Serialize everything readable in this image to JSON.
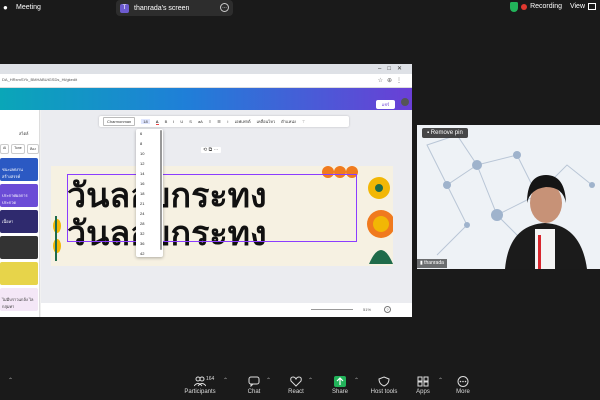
{
  "topbar": {
    "app_title": "Meeting",
    "screen_owner_initial": "T",
    "screen_label": "thanrada's screen",
    "recording_label": "Recording",
    "view_label": "View"
  },
  "browser": {
    "url": "DA_HRxmSYk_BMHABUtGSDs_Hl/gkedit"
  },
  "canva": {
    "share_button": "แชร์",
    "left_panel_title": "สไตล์",
    "chips": [
      "Al",
      "Tone",
      "ห้อง"
    ],
    "thumbs": [
      "ชนะเลศงานสร้างสรรค์",
      "ประกาศผลการประกวด",
      "เนื้อหา",
      "",
      "",
      "ไม่มีบราวแกล้ง ไลกลุ่มทา"
    ],
    "toolbar": {
      "font": "Charmonman",
      "size": "18",
      "effects": "เอฟเฟกต์",
      "animate": "เคลื่อนไหว",
      "position": "ตำแหน่ง"
    },
    "font_sizes": [
      "6",
      "8",
      "10",
      "12",
      "14",
      "16",
      "18",
      "21",
      "24",
      "28",
      "32",
      "36",
      "42"
    ],
    "canvas_text_line1": "วันลอยกระทง",
    "canvas_text_line2": "วันลอยกระทง",
    "zoom": "51%",
    "help": "?"
  },
  "video": {
    "remove_pin_label": "Remove pin",
    "participant_name": "thanrada"
  },
  "toolbar": {
    "participants_label": "Participants",
    "participants_count": "164",
    "chat_label": "Chat",
    "react_label": "React",
    "share_label": "Share",
    "host_tools_label": "Host tools",
    "apps_label": "Apps",
    "more_label": "More"
  },
  "colors": {
    "accent_purple": "#8b3dff",
    "canva_gradient_start": "#0aa6b8",
    "canva_gradient_end": "#6a3fd6",
    "share_green": "#22b35a",
    "record_red": "#e0382f"
  }
}
